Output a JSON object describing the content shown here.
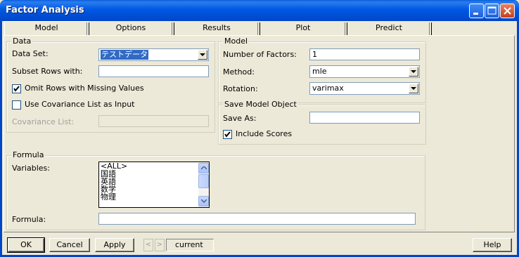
{
  "window": {
    "title": "Factor Analysis"
  },
  "tabs": [
    {
      "label": "Model",
      "active": true
    },
    {
      "label": "Options",
      "active": false
    },
    {
      "label": "Results",
      "active": false
    },
    {
      "label": "Plot",
      "active": false
    },
    {
      "label": "Predict",
      "active": false
    }
  ],
  "data_group": {
    "title": "Data",
    "data_set": {
      "label": "Data Set:",
      "value": "テストデータ"
    },
    "subset_rows": {
      "label": "Subset Rows with:",
      "value": ""
    },
    "omit_missing": {
      "label": "Omit Rows with Missing Values",
      "checked": true
    },
    "use_covariance": {
      "label": "Use Covariance List as Input",
      "checked": false
    },
    "covariance_list": {
      "label": "Covariance List:",
      "value": "",
      "enabled": false
    }
  },
  "model_group": {
    "title": "Model",
    "num_factors": {
      "label": "Number of Factors:",
      "value": "1"
    },
    "method": {
      "label": "Method:",
      "value": "mle"
    },
    "rotation": {
      "label": "Rotation:",
      "value": "varimax"
    }
  },
  "save_group": {
    "title": "Save Model Object",
    "save_as": {
      "label": "Save As:",
      "value": ""
    },
    "include_scores": {
      "label": "Include Scores",
      "checked": true
    }
  },
  "formula_group": {
    "title": "Formula",
    "variables_label": "Variables:",
    "variables": [
      "<ALL>",
      "国語",
      "英語",
      "数学",
      "物理"
    ],
    "formula_label": "Formula:",
    "formula_value": ""
  },
  "buttons": {
    "ok": "OK",
    "cancel": "Cancel",
    "apply": "Apply",
    "prev": "<",
    "next": ">",
    "status": "current",
    "help": "Help"
  },
  "colors": {
    "title_bar": "#0058e3",
    "dialog_bg": "#ece9d8",
    "selection": "#316ac5",
    "close_button": "#c6401c"
  },
  "icons": [
    "minimize-icon",
    "maximize-icon",
    "close-icon",
    "chevron-down-icon",
    "checkmark-icon",
    "scroll-up-icon",
    "scroll-down-icon"
  ]
}
